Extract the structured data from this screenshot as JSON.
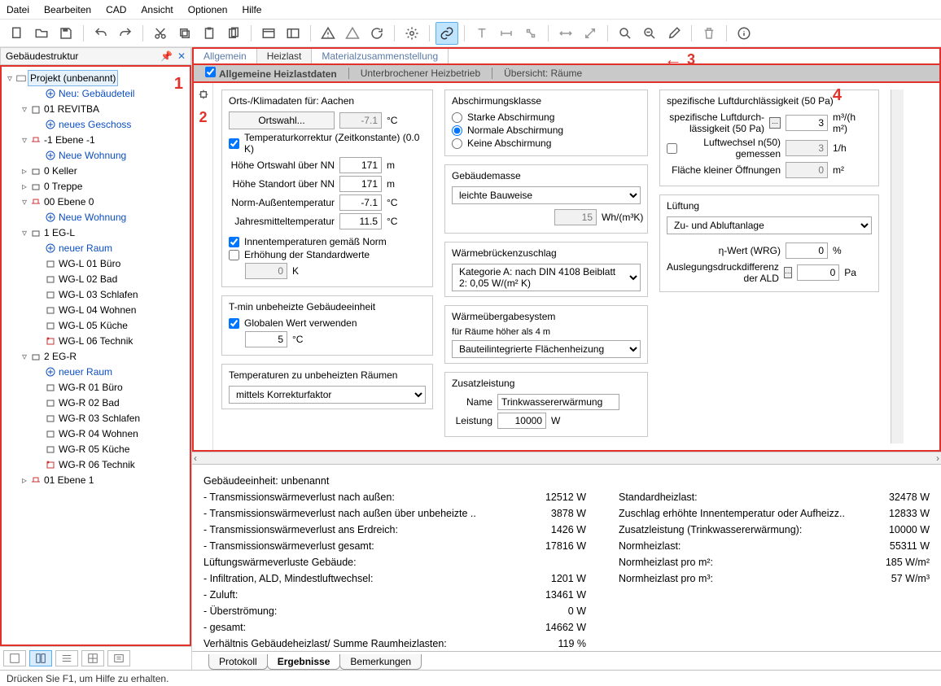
{
  "menu": {
    "items": [
      "Datei",
      "Bearbeiten",
      "CAD",
      "Ansicht",
      "Optionen",
      "Hilfe"
    ]
  },
  "sidebar": {
    "title": "Gebäudestruktur",
    "annot": "1",
    "root": "Projekt (unbenannt)",
    "items": [
      {
        "indent": 2,
        "exp": "",
        "icon": "plus",
        "label": "Neu: Gebäudeteil",
        "blue": true
      },
      {
        "indent": 1,
        "exp": "▿",
        "icon": "bldg",
        "label": "01 REVITBA"
      },
      {
        "indent": 2,
        "exp": "",
        "icon": "plus",
        "label": "neues Geschoss",
        "blue": true
      },
      {
        "indent": 1,
        "exp": "▿",
        "icon": "floor",
        "label": "-1 Ebene -1"
      },
      {
        "indent": 2,
        "exp": "",
        "icon": "plus",
        "label": "Neue Wohnung",
        "blue": true
      },
      {
        "indent": 1,
        "exp": "▹",
        "icon": "unit",
        "label": "0 Keller"
      },
      {
        "indent": 1,
        "exp": "▹",
        "icon": "unit",
        "label": "0 Treppe"
      },
      {
        "indent": 1,
        "exp": "▿",
        "icon": "floor",
        "label": "00 Ebene 0"
      },
      {
        "indent": 2,
        "exp": "",
        "icon": "plus",
        "label": "Neue Wohnung",
        "blue": true
      },
      {
        "indent": 1,
        "exp": "▿",
        "icon": "unit",
        "label": "1 EG-L"
      },
      {
        "indent": 2,
        "exp": "",
        "icon": "plus",
        "label": "neuer Raum",
        "blue": true
      },
      {
        "indent": 2,
        "exp": "",
        "icon": "room",
        "label": "WG-L 01 Büro"
      },
      {
        "indent": 2,
        "exp": "",
        "icon": "room",
        "label": "WG-L 02 Bad"
      },
      {
        "indent": 2,
        "exp": "",
        "icon": "room",
        "label": "WG-L 03 Schlafen"
      },
      {
        "indent": 2,
        "exp": "",
        "icon": "room",
        "label": "WG-L 04 Wohnen"
      },
      {
        "indent": 2,
        "exp": "",
        "icon": "room",
        "label": "WG-L 05 Küche"
      },
      {
        "indent": 2,
        "exp": "",
        "icon": "room-w",
        "label": "WG-L 06 Technik"
      },
      {
        "indent": 1,
        "exp": "▿",
        "icon": "unit",
        "label": "2 EG-R"
      },
      {
        "indent": 2,
        "exp": "",
        "icon": "plus",
        "label": "neuer Raum",
        "blue": true
      },
      {
        "indent": 2,
        "exp": "",
        "icon": "room",
        "label": "WG-R 01 Büro"
      },
      {
        "indent": 2,
        "exp": "",
        "icon": "room",
        "label": "WG-R 02 Bad"
      },
      {
        "indent": 2,
        "exp": "",
        "icon": "room",
        "label": "WG-R 03 Schlafen"
      },
      {
        "indent": 2,
        "exp": "",
        "icon": "room",
        "label": "WG-R 04 Wohnen"
      },
      {
        "indent": 2,
        "exp": "",
        "icon": "room",
        "label": "WG-R 05 Küche"
      },
      {
        "indent": 2,
        "exp": "",
        "icon": "room-w",
        "label": "WG-R 06 Technik"
      },
      {
        "indent": 1,
        "exp": "▹",
        "icon": "floor",
        "label": "01 Ebene 1"
      }
    ]
  },
  "content_tabs": {
    "items": [
      "Allgemein",
      "Heizlast",
      "Materialzusammenstellung"
    ],
    "active": 1,
    "annot": "3"
  },
  "subtabs": {
    "items": [
      "Allgemeine Heizlastdaten",
      "Unterbrochener Heizbetrieb",
      "Übersicht: Räume"
    ],
    "active": 0
  },
  "vstrip_annot": "2",
  "panel_annot": "4",
  "klima": {
    "title_prefix": "Orts-/Klimadaten für:",
    "ort": "Aachen",
    "ortswahl_btn": "Ortswahl...",
    "ortswahl_temp": "-7.1",
    "ortswahl_unit": "°C",
    "tk_check": "Temperaturkorrektur (Zeitkonstante) (0.0 K)",
    "rows": [
      {
        "label": "Höhe Ortswahl über NN",
        "val": "171",
        "unit": "m"
      },
      {
        "label": "Höhe Standort über NN",
        "val": "171",
        "unit": "m"
      },
      {
        "label": "Norm-Außentemperatur",
        "val": "-7.1",
        "unit": "°C"
      },
      {
        "label": "Jahresmitteltemperatur",
        "val": "11.5",
        "unit": "°C"
      }
    ],
    "innentemp_check": "Innentemperaturen gemäß Norm",
    "erhoehung_check": "Erhöhung der Standardwerte",
    "erhoehung_val": "0",
    "erhoehung_unit": "K"
  },
  "tmin": {
    "title": "T-min unbeheizte Gebäudeeinheit",
    "global_check": "Globalen Wert verwenden",
    "val": "5",
    "unit": "°C"
  },
  "temp_unbeheiz": {
    "title": "Temperaturen zu unbeheizten Räumen",
    "value": "mittels Korrekturfaktor"
  },
  "abschirm": {
    "title": "Abschirmungsklasse",
    "options": [
      "Starke Abschirmung",
      "Normale Abschirmung",
      "Keine Abschirmung"
    ],
    "selected": 1
  },
  "masse": {
    "title": "Gebäudemasse",
    "value": "leichte Bauweise",
    "wh": "15",
    "wh_unit": "Wh/(m³K)"
  },
  "wb": {
    "title": "Wärmebrückenzuschlag",
    "value": "Kategorie A: nach DIN 4108 Beiblatt 2: 0,05 W/(m² K)"
  },
  "wueb": {
    "title": "Wärmeübergabesystem",
    "sub": "für Räume höher als 4 m",
    "value": "Bauteilintegrierte Flächenheizung"
  },
  "zusatz": {
    "title": "Zusatzleistung",
    "name_label": "Name",
    "name_value": "Trinkwassererwärmung",
    "leistung_label": "Leistung",
    "leistung_value": "10000",
    "leistung_unit": "W"
  },
  "spezluft": {
    "title": "spezifische Luftdurchlässigkeit (50 Pa)",
    "rows": [
      {
        "label": "spezifische Luftdurch-lässigkeit (50 Pa)",
        "val": "3",
        "unit": "m³/(h m²)",
        "calc": true
      },
      {
        "label": "Luftwechsel n(50) gemessen",
        "val": "3",
        "unit": "1/h",
        "ro": true,
        "check": true
      },
      {
        "label": "Fläche kleiner Öffnungen",
        "val": "0",
        "unit": "m²",
        "ro": true
      }
    ]
  },
  "lueftung": {
    "title": "Lüftung",
    "value": "Zu- und Abluftanlage",
    "eta_label": "η-Wert (WRG)",
    "eta_val": "0",
    "eta_unit": "%",
    "ald_label": "Auslegungsdruckdifferenz der ALD",
    "ald_val": "0",
    "ald_unit": "Pa"
  },
  "results": {
    "heading": "Gebäudeeinheit: unbenannt",
    "left": [
      {
        "k": "- Transmissionswärmeverlust nach außen:",
        "v": "12512 W"
      },
      {
        "k": "- Transmissionswärmeverlust nach außen über unbeheizte ..",
        "v": "3878 W"
      },
      {
        "k": "- Transmissionswärmeverlust ans Erdreich:",
        "v": "1426 W"
      },
      {
        "k": "- Transmissionswärmeverlust gesamt:",
        "v": "17816 W"
      },
      {
        "k": "Lüftungswärmeverluste Gebäude:",
        "v": ""
      },
      {
        "k": "- Infiltration, ALD, Mindestluftwechsel:",
        "v": "1201 W"
      },
      {
        "k": "- Zuluft:",
        "v": "13461 W"
      },
      {
        "k": "- Überströmung:",
        "v": "0 W"
      },
      {
        "k": "- gesamt:",
        "v": "14662 W"
      },
      {
        "k": " ",
        "v": ""
      },
      {
        "k": "Verhältnis Gebäudeheizlast/ Summe Raumheizlasten:",
        "v": "119 %"
      }
    ],
    "right": [
      {
        "k": "Standardheizlast:",
        "v": "32478 W"
      },
      {
        "k": "Zuschlag erhöhte Innentemperatur oder Aufheizz..",
        "v": "12833 W"
      },
      {
        "k": "Zusatzleistung (Trinkwassererwärmung):",
        "v": "10000 W"
      },
      {
        "k": "Normheizlast:",
        "v": "55311 W"
      },
      {
        "k": "Normheizlast pro m²:",
        "v": "185 W/m²"
      },
      {
        "k": "Normheizlast pro m³:",
        "v": "57 W/m³"
      }
    ]
  },
  "bottom_tabs": {
    "items": [
      "Protokoll",
      "Ergebnisse",
      "Bemerkungen"
    ],
    "active": 1
  },
  "status": "Drücken Sie F1, um Hilfe zu erhalten."
}
